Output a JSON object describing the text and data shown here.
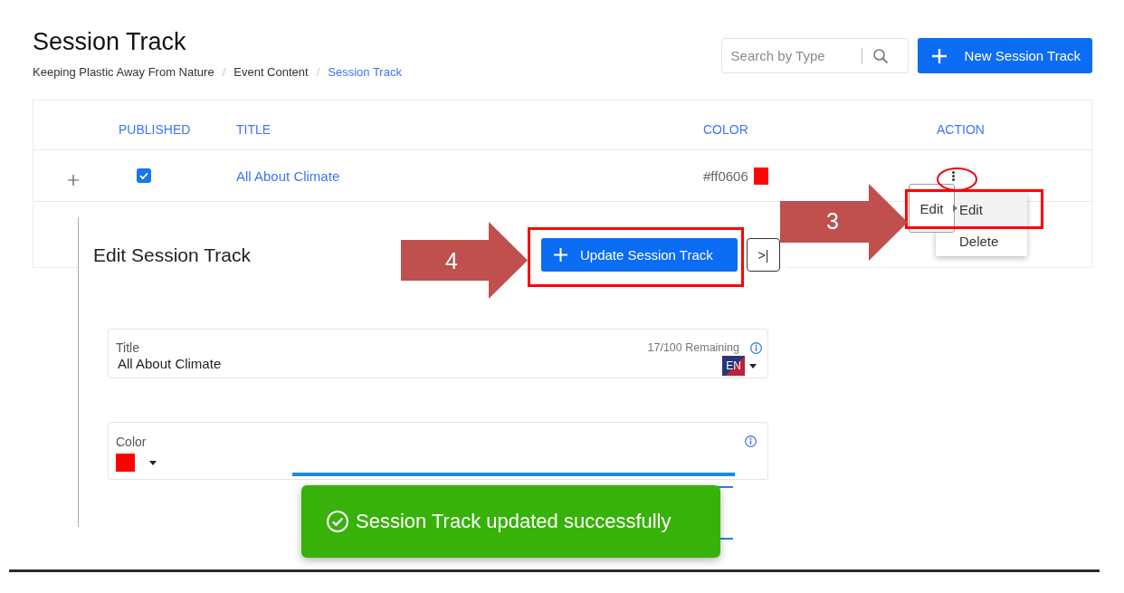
{
  "header": {
    "title": "Session Track",
    "breadcrumb": {
      "separator": "/",
      "items": [
        {
          "label": "Keeping Plastic Away From Nature",
          "current": false
        },
        {
          "label": "Event Content",
          "current": false
        },
        {
          "label": "Session Track",
          "current": true
        }
      ]
    }
  },
  "search": {
    "placeholder": "Search by Type"
  },
  "new_button": {
    "label": "New Session Track"
  },
  "table": {
    "columns": [
      "PUBLISHED",
      "TITLE",
      "COLOR",
      "ACTION"
    ],
    "rows": [
      {
        "published": true,
        "title": "All About Climate",
        "color_code": "#ff0606",
        "color": "#ff0606"
      }
    ]
  },
  "action_menu": {
    "tooltip": "Edit",
    "callout": "3",
    "items": [
      {
        "label": "Edit",
        "selected": true
      },
      {
        "label": "Delete",
        "selected": false
      }
    ]
  },
  "edit_panel": {
    "title": "Edit Session Track",
    "callout": "4",
    "submit_button": "Update Session Track",
    "collapse_button": ">|",
    "fields": [
      {
        "kind": "text",
        "label": "Title",
        "value": "All About Climate",
        "counter": "17/100 Remaining",
        "language": "EN"
      },
      {
        "kind": "color",
        "label": "Color",
        "color": "#ff0000"
      }
    ]
  },
  "toast": {
    "message": "Session Track updated successfully"
  }
}
